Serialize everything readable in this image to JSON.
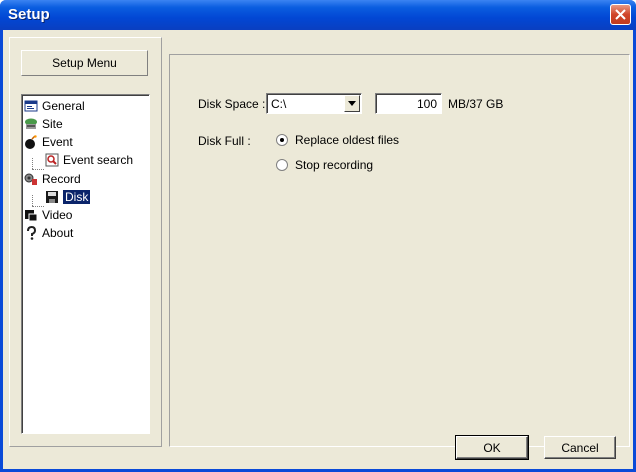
{
  "window": {
    "title": "Setup"
  },
  "left": {
    "menu_button": "Setup Menu",
    "tree": [
      {
        "label": "General",
        "icon": "general-icon"
      },
      {
        "label": "Site",
        "icon": "site-icon"
      },
      {
        "label": "Event",
        "icon": "event-icon"
      },
      {
        "label": "Event search",
        "icon": "event-search-icon"
      },
      {
        "label": "Record",
        "icon": "record-icon"
      },
      {
        "label": "Disk",
        "icon": "disk-icon"
      },
      {
        "label": "Video",
        "icon": "video-icon"
      },
      {
        "label": "About",
        "icon": "about-icon"
      }
    ]
  },
  "disk": {
    "space_label": "Disk Space :",
    "drive_value": "C:\\",
    "size_value": "100",
    "size_unit": "MB/37 GB",
    "full_label": "Disk Full :",
    "options": [
      {
        "label": "Replace oldest files",
        "checked": true
      },
      {
        "label": "Stop recording",
        "checked": false
      }
    ]
  },
  "buttons": {
    "ok": "OK",
    "cancel": "Cancel"
  }
}
